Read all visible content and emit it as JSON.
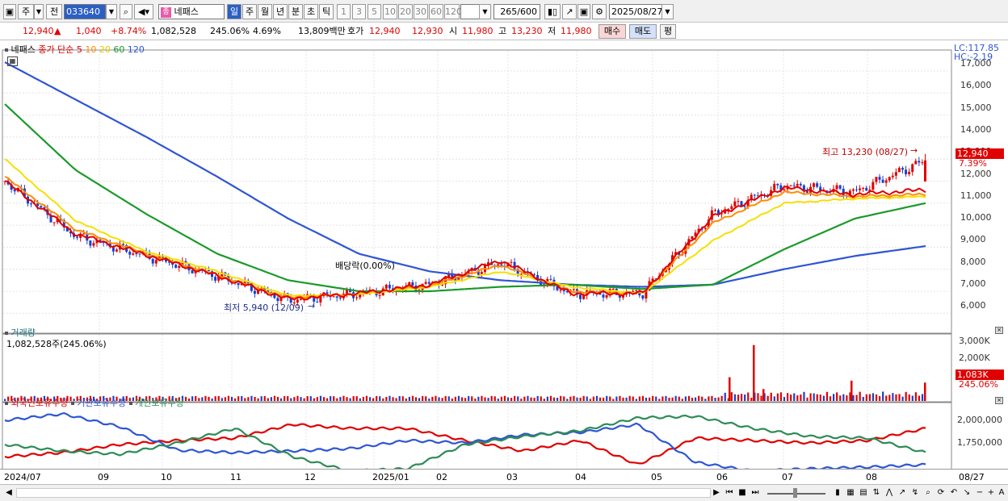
{
  "toolbar": {
    "market_code": "주",
    "prev_label": "전",
    "stock_code": "033640",
    "stock_name": "네패스",
    "period_buttons": [
      "일",
      "주",
      "월",
      "년",
      "분",
      "초",
      "틱"
    ],
    "interval_buttons": [
      "1",
      "3",
      "5",
      "10",
      "20",
      "30",
      "60",
      "120"
    ],
    "count_display": "265",
    "count_total": "/600",
    "date": "2025/08/27"
  },
  "quote": {
    "price": "12,940",
    "arrow": "▲",
    "change": "1,040",
    "change_pct": "+8.74%",
    "volume": "1,082,528",
    "volume_ratio": "245.06%",
    "turnover": "4.69%",
    "amount": "13,809백만",
    "bid_label": "호가",
    "ask_price": "12,940",
    "bid_price": "12,930",
    "open_label": "시",
    "open": "11,980",
    "high_label": "고",
    "high": "13,230",
    "low_label": "저",
    "low": "11,980",
    "buy_label": "매수",
    "sell_label": "매도",
    "eval_label": "평"
  },
  "price_panel": {
    "title": "네패스",
    "ma_label": "종가 단순",
    "ma_periods": [
      "5",
      "10",
      "20",
      "60",
      "120"
    ],
    "ma_colors": [
      "#e00000",
      "#ff8c00",
      "#f5e000",
      "#1a9a2a",
      "#2f55d4"
    ],
    "lc": "LC:117.85",
    "hc": "HC:-2.19",
    "current_tag": "12,940",
    "current_pct": "7.39%",
    "high_annotation": "최고 13,230 (08/27)",
    "low_annotation": "최저 5,940 (12/09)",
    "dividend_annotation": "배당락(0.00%)",
    "y_ticks": [
      "17,000",
      "16,000",
      "15,000",
      "14,000",
      "13,000",
      "12,000",
      "11,000",
      "10,000",
      "9,000",
      "8,000",
      "7,000",
      "6,000"
    ]
  },
  "volume_panel": {
    "title": "거래량",
    "value": "1,082,528주(245.06%)",
    "y_ticks": [
      "3,000K",
      "2,000K",
      "1,000K"
    ],
    "current_tag": "1,083K",
    "current_pct": "245.06%"
  },
  "holding_panel": {
    "series_labels": [
      "외국인보유수량",
      "기관보유수량",
      "개인보유수량"
    ],
    "series_colors": [
      "#e00000",
      "#2f55d4",
      "#2e8b57"
    ],
    "y_ticks": [
      "2,000,000",
      "1,750,000"
    ]
  },
  "x_axis": {
    "labels": [
      "2024/07",
      "09",
      "10",
      "11",
      "12",
      "2025/01",
      "02",
      "03",
      "04",
      "05",
      "06",
      "07",
      "08"
    ],
    "current_date": "08/27"
  },
  "chart_data": {
    "type": "line",
    "title": "네패스",
    "x": [
      "2024/07",
      "09",
      "10",
      "11",
      "12",
      "2025/01",
      "02",
      "03",
      "04",
      "05",
      "06",
      "07",
      "08",
      "08/27"
    ],
    "series": [
      {
        "name": "종가",
        "values": [
          12000,
          9500,
          8600,
          7700,
          6600,
          6900,
          7300,
          8300,
          6900,
          6900,
          10500,
          11800,
          11500,
          12940
        ]
      },
      {
        "name": "5",
        "values": [
          12000,
          9600,
          8650,
          7700,
          6650,
          6900,
          7300,
          8400,
          6900,
          6900,
          10400,
          11700,
          11400,
          11600
        ]
      },
      {
        "name": "10",
        "values": [
          12200,
          9800,
          8700,
          7750,
          6700,
          6900,
          7250,
          8200,
          7000,
          6900,
          10100,
          11500,
          11300,
          11400
        ]
      },
      {
        "name": "20",
        "values": [
          13000,
          10200,
          8800,
          7900,
          6800,
          6850,
          7200,
          7900,
          7200,
          6900,
          9300,
          11000,
          11200,
          11300
        ]
      },
      {
        "name": "60",
        "values": [
          15500,
          12500,
          10500,
          8700,
          7500,
          7000,
          7000,
          7200,
          7300,
          7100,
          7300,
          8900,
          10300,
          11000
        ]
      },
      {
        "name": "120",
        "values": [
          17400,
          15700,
          14000,
          12200,
          10300,
          8700,
          7900,
          7500,
          7300,
          7200,
          7300,
          8000,
          8600,
          9050
        ]
      }
    ],
    "ylim": [
      5500,
      17500
    ]
  }
}
